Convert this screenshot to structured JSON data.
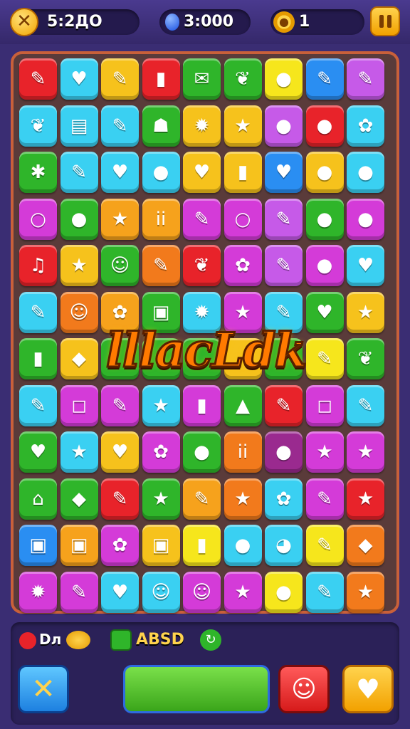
{
  "hud": {
    "coins": "5:2ДО",
    "gems": "3:000",
    "level": "1",
    "coin_icon": "cross-coin-icon",
    "gem_icon": "blue-gem-icon",
    "gear_icon": "gear-icon",
    "pause_icon": "pause-icon"
  },
  "banner": {
    "text": "lllacLdk"
  },
  "board": {
    "rows": [
      [
        {
          "c": "#e8232a",
          "g": "✎"
        },
        {
          "c": "#3ad0f2",
          "g": "♥"
        },
        {
          "c": "#f6c21c",
          "g": "✎"
        },
        {
          "c": "#e8232a",
          "g": "▮"
        },
        {
          "c": "#2fb52a",
          "g": "✉"
        },
        {
          "c": "#2fb52a",
          "g": "❦"
        },
        {
          "c": "#f6e61c",
          "g": "●"
        },
        {
          "c": "#2a8ef2",
          "g": "✎"
        },
        {
          "c": "#c65ae8",
          "g": "✎"
        }
      ],
      [
        {
          "c": "#3ad0f2",
          "g": "❦"
        },
        {
          "c": "#3ad0f2",
          "g": "▤"
        },
        {
          "c": "#3ad0f2",
          "g": "✎"
        },
        {
          "c": "#2fb52a",
          "g": "☗"
        },
        {
          "c": "#f6c21c",
          "g": "✹"
        },
        {
          "c": "#f6c21c",
          "g": "★"
        },
        {
          "c": "#c65ae8",
          "g": "●"
        },
        {
          "c": "#e8232a",
          "g": "●"
        },
        {
          "c": "#3ad0f2",
          "g": "✿"
        }
      ],
      [
        {
          "c": "#2fb52a",
          "g": "✱"
        },
        {
          "c": "#3ad0f2",
          "g": "✎"
        },
        {
          "c": "#3ad0f2",
          "g": "♥"
        },
        {
          "c": "#3ad0f2",
          "g": "●"
        },
        {
          "c": "#f6c21c",
          "g": "♥"
        },
        {
          "c": "#f6c21c",
          "g": "▮"
        },
        {
          "c": "#2a8ef2",
          "g": "♥"
        },
        {
          "c": "#f6c21c",
          "g": "●"
        },
        {
          "c": "#3ad0f2",
          "g": "●"
        }
      ],
      [
        {
          "c": "#d43bd8",
          "g": "○"
        },
        {
          "c": "#2fb52a",
          "g": "●"
        },
        {
          "c": "#f6a21c",
          "g": "★"
        },
        {
          "c": "#f6a21c",
          "g": "ii"
        },
        {
          "c": "#d43bd8",
          "g": "✎"
        },
        {
          "c": "#d43bd8",
          "g": "○"
        },
        {
          "c": "#c65ae8",
          "g": "✎"
        },
        {
          "c": "#2fb52a",
          "g": "●"
        },
        {
          "c": "#d43bd8",
          "g": "●"
        }
      ],
      [
        {
          "c": "#e8232a",
          "g": "♫"
        },
        {
          "c": "#f6c21c",
          "g": "★"
        },
        {
          "c": "#2fb52a",
          "g": "☺"
        },
        {
          "c": "#f27a1c",
          "g": "✎"
        },
        {
          "c": "#e8232a",
          "g": "❦"
        },
        {
          "c": "#d43bd8",
          "g": "✿"
        },
        {
          "c": "#c65ae8",
          "g": "✎"
        },
        {
          "c": "#d43bd8",
          "g": "●"
        },
        {
          "c": "#3ad0f2",
          "g": "♥"
        }
      ],
      [
        {
          "c": "#3ad0f2",
          "g": "✎"
        },
        {
          "c": "#f27a1c",
          "g": "☺"
        },
        {
          "c": "#f6a21c",
          "g": "✿"
        },
        {
          "c": "#2fb52a",
          "g": "▣"
        },
        {
          "c": "#3ad0f2",
          "g": "✹"
        },
        {
          "c": "#d43bd8",
          "g": "★"
        },
        {
          "c": "#3ad0f2",
          "g": "✎"
        },
        {
          "c": "#2fb52a",
          "g": "♥"
        },
        {
          "c": "#f6c21c",
          "g": "★"
        }
      ],
      [
        {
          "c": "#2fb52a",
          "g": "▮"
        },
        {
          "c": "#f6c21c",
          "g": "◆"
        },
        {
          "c": "#2fb52a",
          "g": ""
        },
        {
          "c": "#2fb52a",
          "g": ""
        },
        {
          "c": "#2fb52a",
          "g": ""
        },
        {
          "c": "#f6c21c",
          "g": ""
        },
        {
          "c": "#2fb52a",
          "g": ""
        },
        {
          "c": "#f6e61c",
          "g": "✎"
        },
        {
          "c": "#2fb52a",
          "g": "❦"
        }
      ],
      [
        {
          "c": "#3ad0f2",
          "g": "✎"
        },
        {
          "c": "#d43bd8",
          "g": "◻"
        },
        {
          "c": "#d43bd8",
          "g": "✎"
        },
        {
          "c": "#3ad0f2",
          "g": "★"
        },
        {
          "c": "#d43bd8",
          "g": "▮"
        },
        {
          "c": "#2fb52a",
          "g": "▲"
        },
        {
          "c": "#e8232a",
          "g": "✎"
        },
        {
          "c": "#d43bd8",
          "g": "◻"
        },
        {
          "c": "#3ad0f2",
          "g": "✎"
        }
      ],
      [
        {
          "c": "#2fb52a",
          "g": "♥"
        },
        {
          "c": "#3ad0f2",
          "g": "★"
        },
        {
          "c": "#f6c21c",
          "g": "♥"
        },
        {
          "c": "#d43bd8",
          "g": "✿"
        },
        {
          "c": "#2fb52a",
          "g": "●"
        },
        {
          "c": "#f27a1c",
          "g": "ii"
        },
        {
          "c": "#9a2a8f",
          "g": "●"
        },
        {
          "c": "#d43bd8",
          "g": "★"
        },
        {
          "c": "#d43bd8",
          "g": "★"
        }
      ],
      [
        {
          "c": "#2fb52a",
          "g": "⌂"
        },
        {
          "c": "#2fb52a",
          "g": "◆"
        },
        {
          "c": "#e8232a",
          "g": "✎"
        },
        {
          "c": "#2fb52a",
          "g": "★"
        },
        {
          "c": "#f6a21c",
          "g": "✎"
        },
        {
          "c": "#f27a1c",
          "g": "★"
        },
        {
          "c": "#3ad0f2",
          "g": "✿"
        },
        {
          "c": "#d43bd8",
          "g": "✎"
        },
        {
          "c": "#e8232a",
          "g": "★"
        }
      ],
      [
        {
          "c": "#2a8ef2",
          "g": "▣"
        },
        {
          "c": "#f6a21c",
          "g": "▣"
        },
        {
          "c": "#d43bd8",
          "g": "✿"
        },
        {
          "c": "#f6c21c",
          "g": "▣"
        },
        {
          "c": "#f6e61c",
          "g": "▮"
        },
        {
          "c": "#3ad0f2",
          "g": "●"
        },
        {
          "c": "#3ad0f2",
          "g": "◕"
        },
        {
          "c": "#f6e61c",
          "g": "✎"
        },
        {
          "c": "#f27a1c",
          "g": "◆"
        }
      ],
      [
        {
          "c": "#d43bd8",
          "g": "✹"
        },
        {
          "c": "#d43bd8",
          "g": "✎"
        },
        {
          "c": "#3ad0f2",
          "g": "♥"
        },
        {
          "c": "#3ad0f2",
          "g": "☺"
        },
        {
          "c": "#d43bd8",
          "g": "☺"
        },
        {
          "c": "#d43bd8",
          "g": "★"
        },
        {
          "c": "#f6e61c",
          "g": "●"
        },
        {
          "c": "#3ad0f2",
          "g": "✎"
        },
        {
          "c": "#f27a1c",
          "g": "★"
        }
      ]
    ]
  },
  "footer": {
    "left_badge": "Dл",
    "score_label": "ABSD",
    "buttons": {
      "shuffle_icon": "cross-bandage-icon",
      "main_bar_icon": "green-bar",
      "face_icon": "face-icon",
      "heart_icon": "heart-icon"
    }
  }
}
